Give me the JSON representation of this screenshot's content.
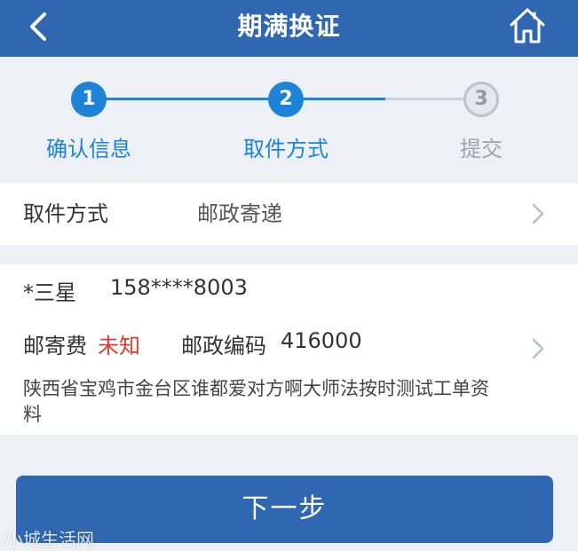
{
  "header": {
    "title": "期满换证",
    "back_icon": "chevron-left-icon",
    "home_icon": "home-icon"
  },
  "steps": [
    {
      "number": "1",
      "label": "确认信息",
      "state": "done"
    },
    {
      "number": "2",
      "label": "取件方式",
      "state": "active"
    },
    {
      "number": "3",
      "label": "提交",
      "state": "todo"
    }
  ],
  "pickup": {
    "label": "取件方式",
    "value": "邮政寄递"
  },
  "address": {
    "name": "*三星",
    "phone": "158****8003",
    "fee_label": "邮寄费",
    "fee_value": "未知",
    "postcode_label": "邮政编码",
    "postcode_value": "416000",
    "full": "陕西省宝鸡市金台区谁都爱对方啊大师法按时测试工单资料"
  },
  "next_button": "下一步",
  "watermark": "小城生活网",
  "colors": {
    "primary": "#2f67b0",
    "step_active": "#1d83d6",
    "fee_unknown": "#e23a2b"
  }
}
